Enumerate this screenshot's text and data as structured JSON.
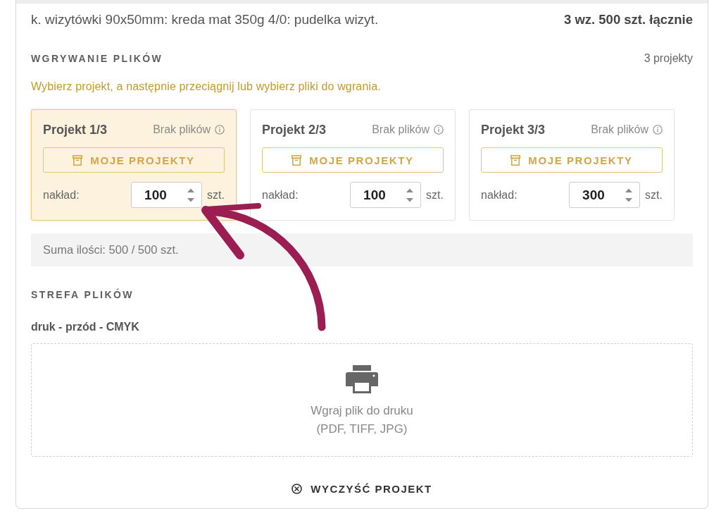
{
  "order": {
    "description": "k. wizytówki 90x50mm: kreda mat 350g 4/0: pudelka wizyt.",
    "total": "3 wz. 500 szt. łącznie"
  },
  "upload": {
    "heading": "WGRYWANIE PLIKÓW",
    "count": "3 projekty",
    "hint": "Wybierz projekt, a następnie przeciągnij lub wybierz pliki do wgrania.",
    "projects": [
      {
        "title": "Projekt 1/3",
        "status": "Brak plików",
        "button": "MOJE PROJEKTY",
        "quantity_label": "nakład:",
        "quantity": "100",
        "unit": "szt.",
        "selected": true
      },
      {
        "title": "Projekt 2/3",
        "status": "Brak plików",
        "button": "MOJE PROJEKTY",
        "quantity_label": "nakład:",
        "quantity": "100",
        "unit": "szt.",
        "selected": false
      },
      {
        "title": "Projekt 3/3",
        "status": "Brak plików",
        "button": "MOJE PROJEKTY",
        "quantity_label": "nakład:",
        "quantity": "300",
        "unit": "szt.",
        "selected": false
      }
    ],
    "summary": "Suma ilości: 500 / 500 szt."
  },
  "files": {
    "heading": "STREFA PLIKÓW",
    "label": "druk - przód - CMYK",
    "dropzone": {
      "title": "Wgraj plik do druku",
      "formats": "(PDF, TIFF, JPG)"
    }
  },
  "clear_button": "WYCZYŚĆ PROJEKT"
}
